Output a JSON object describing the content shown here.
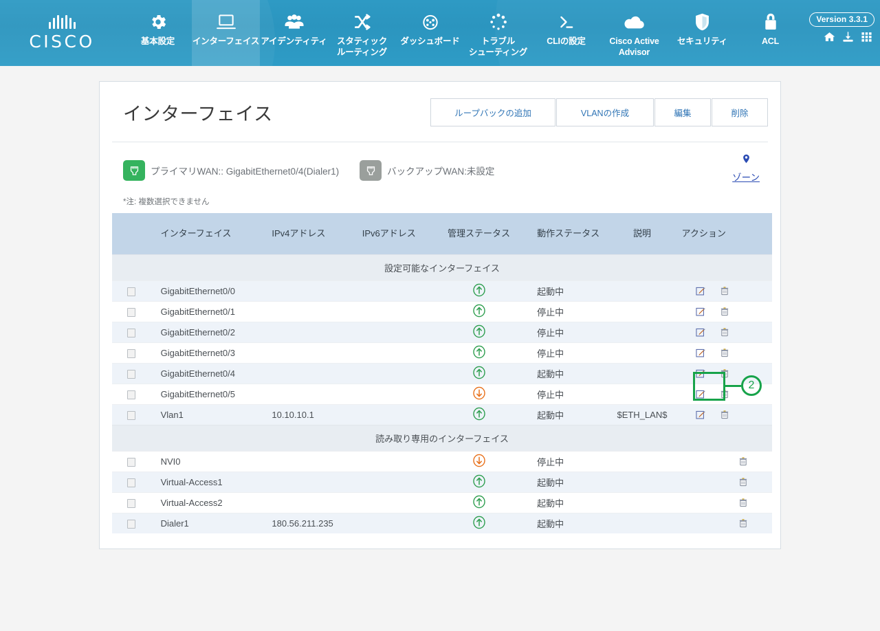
{
  "nav": {
    "logo_text": "CISCO",
    "items": [
      {
        "label": "基本設定",
        "icon": "gear-icon",
        "active": false
      },
      {
        "label": "インターフェイス",
        "icon": "monitor-icon",
        "active": true
      },
      {
        "label": "アイデンティティ",
        "icon": "users-icon",
        "active": false
      },
      {
        "label": "スタティック\nルーティング",
        "icon": "shuffle-icon",
        "active": false
      },
      {
        "label": "ダッシュボード",
        "icon": "gauge-icon",
        "active": false
      },
      {
        "label": "トラブル\nシューティング",
        "icon": "spinner-icon",
        "active": false
      },
      {
        "label": "CLIの設定",
        "icon": "terminal-icon",
        "active": false
      },
      {
        "label": "Cisco Active\nAdvisor",
        "icon": "cloud-upload-icon",
        "active": false
      },
      {
        "label": "セキュリティ",
        "icon": "shield-icon",
        "active": false
      },
      {
        "label": "ACL",
        "icon": "lock-icon",
        "active": false
      }
    ],
    "version_badge": "Version 3.3.1",
    "right_icons": [
      "home-icon",
      "download-icon",
      "grid-icon"
    ]
  },
  "header": {
    "title": "インターフェイス",
    "buttons": [
      {
        "label": "ループバックの追加",
        "size": "w-lg"
      },
      {
        "label": "VLANの作成",
        "size": "w-md"
      },
      {
        "label": "編集",
        "size": "w-sm"
      },
      {
        "label": "削除",
        "size": "w-sm"
      }
    ]
  },
  "wan": {
    "primary": {
      "text": "プライマリWAN:: GigabitEthernet0/4(Dialer1)",
      "color": "#35b35e"
    },
    "backup": {
      "text": "バックアップWAN:未設定",
      "color": "#9a9f9c"
    },
    "zone_label": "ゾーン"
  },
  "note": "*注: 複数選択できません",
  "table": {
    "columns": [
      "",
      "インターフェイス",
      "IPv4アドレス",
      "IPv6アドレス",
      "管理ステータス",
      "動作ステータス",
      "説明",
      "アクション"
    ],
    "sections": [
      {
        "title": "設定可能なインターフェイス",
        "rows": [
          {
            "name": "GigabitEthernet0/0",
            "ipv4": "",
            "ipv6": "",
            "admin": "up",
            "oper": "起動中",
            "desc": "",
            "actions": [
              "edit",
              "delete"
            ]
          },
          {
            "name": "GigabitEthernet0/1",
            "ipv4": "",
            "ipv6": "",
            "admin": "up",
            "oper": "停止中",
            "desc": "",
            "actions": [
              "edit",
              "delete"
            ]
          },
          {
            "name": "GigabitEthernet0/2",
            "ipv4": "",
            "ipv6": "",
            "admin": "up",
            "oper": "停止中",
            "desc": "",
            "actions": [
              "edit",
              "delete"
            ]
          },
          {
            "name": "GigabitEthernet0/3",
            "ipv4": "",
            "ipv6": "",
            "admin": "up",
            "oper": "停止中",
            "desc": "",
            "actions": [
              "edit",
              "delete"
            ]
          },
          {
            "name": "GigabitEthernet0/4",
            "ipv4": "",
            "ipv6": "",
            "admin": "up",
            "oper": "起動中",
            "desc": "",
            "actions": [
              "edit",
              "delete"
            ]
          },
          {
            "name": "GigabitEthernet0/5",
            "ipv4": "",
            "ipv6": "",
            "admin": "down",
            "oper": "停止中",
            "desc": "",
            "actions": [
              "edit",
              "delete"
            ]
          },
          {
            "name": "Vlan1",
            "ipv4": "10.10.10.1",
            "ipv6": "",
            "admin": "up",
            "oper": "起動中",
            "desc": "$ETH_LAN$",
            "actions": [
              "edit",
              "delete"
            ]
          }
        ]
      },
      {
        "title": "読み取り専用のインターフェイス",
        "rows": [
          {
            "name": "NVI0",
            "ipv4": "",
            "ipv6": "",
            "admin": "down",
            "oper": "停止中",
            "desc": "",
            "actions": [
              "delete"
            ]
          },
          {
            "name": "Virtual-Access1",
            "ipv4": "",
            "ipv6": "",
            "admin": "up",
            "oper": "起動中",
            "desc": "",
            "actions": [
              "delete"
            ]
          },
          {
            "name": "Virtual-Access2",
            "ipv4": "",
            "ipv6": "",
            "admin": "up",
            "oper": "起動中",
            "desc": "",
            "actions": [
              "delete"
            ]
          },
          {
            "name": "Dialer1",
            "ipv4": "180.56.211.235",
            "ipv6": "",
            "admin": "up",
            "oper": "起動中",
            "desc": "",
            "actions": [
              "delete"
            ]
          }
        ]
      }
    ]
  },
  "annotation": {
    "step_number": "2",
    "color": "#17a34a"
  },
  "colors": {
    "nav_bg": "#2b95bf",
    "status_up": "#2e9e4f",
    "status_down": "#e8701a",
    "table_header_bg": "#c2d5e8",
    "link": "#2f74b5"
  }
}
